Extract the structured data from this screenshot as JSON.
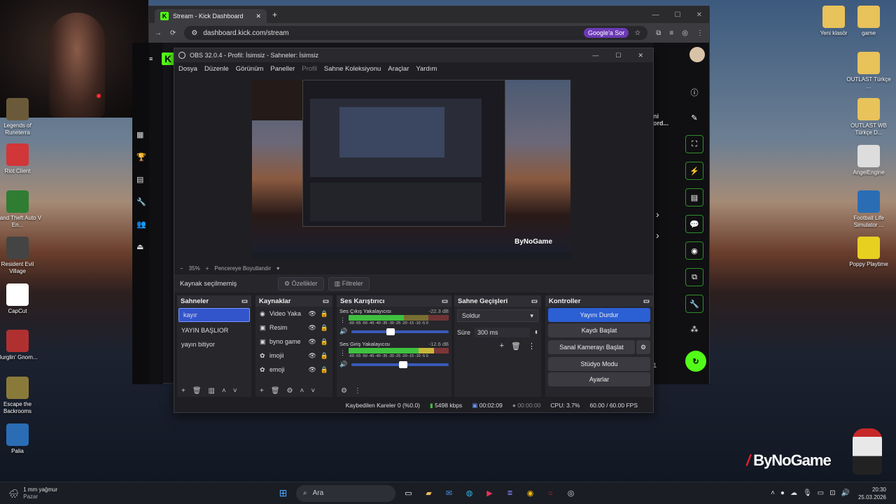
{
  "browser": {
    "tab_title": "Stream - Kick Dashboard",
    "url": "dashboard.kick.com/stream",
    "google_button": "Google'a Sor"
  },
  "kick": {
    "logo": "K",
    "channel_text": "ni\nord...",
    "count": "1"
  },
  "obs": {
    "title": "OBS 32.0.4 - Profil: İsimsiz - Sahneler: İsimsiz",
    "menu": [
      "Dosya",
      "Düzenle",
      "Görünüm",
      "Paneller",
      "Profil",
      "Sahne Koleksiyonu",
      "Araçlar",
      "Yardım"
    ],
    "zoom": "35%",
    "fit_label": "Pencereye Boyutlandır",
    "no_source": "Kaynak seçilmemiş",
    "properties": "Özellikler",
    "filters": "Filtreler",
    "scenes": {
      "title": "Sahneler",
      "items": [
        "kayır",
        "YAYIN BAŞLIOR",
        "yayın bitiyor"
      ]
    },
    "sources": {
      "title": "Kaynaklar",
      "items": [
        "Video Yaka",
        "Resim",
        "byno game",
        "imojii",
        "emoji"
      ]
    },
    "mixer": {
      "title": "Ses Karıştırıcı",
      "ch1_name": "Ses Çıkış Yakalayıcısı",
      "ch1_db": "-22.3 dB",
      "ch2_name": "Ses Giriş Yakalayıcısı",
      "ch2_db": "-12.6 dB",
      "scale": "-60 -55 -50 -45 -40 -35 -30 -25 -20 -15 -10 -5 0"
    },
    "transitions": {
      "title": "Sahne Geçişleri",
      "type": "Soldur",
      "duration_label": "Süre",
      "duration": "300 ms"
    },
    "controls": {
      "title": "Kontroller",
      "stop_stream": "Yayını Durdur",
      "start_record": "Kaydı Başlat",
      "virtual_cam": "Sanal Kamerayı Başlat",
      "studio": "Stüdyo Modu",
      "settings": "Ayarlar"
    },
    "status": {
      "dropped": "Kaybedilen Kareler 0 (%0.0)",
      "bitrate": "5498 kbps",
      "stream_time": "00:02:09",
      "rec_time": "00:00:00",
      "cpu": "CPU: 3.7%",
      "fps": "60.00 / 60.00 FPS"
    },
    "watermark": "ByNoGame"
  },
  "desktop_left": [
    {
      "label": "Legends of Runeterra",
      "color": "#6b5a3a"
    },
    {
      "label": "Riot Client",
      "color": "#d13639"
    },
    {
      "label": "Grand Theft Auto V En...",
      "color": "#2e7d32"
    },
    {
      "label": "Resident Evil Village",
      "color": "#444"
    },
    {
      "label": "CapCut",
      "color": "#ffffff"
    },
    {
      "label": "Burglin' Gnom...",
      "color": "#b03030"
    },
    {
      "label": "Escape the Backrooms",
      "color": "#8a7a3a"
    },
    {
      "label": "Palia",
      "color": "#2a6db5"
    }
  ],
  "desktop_right": [
    {
      "label": "Yeni klasör",
      "color": "#e8c25a"
    },
    {
      "label": "game",
      "color": "#e8c25a"
    },
    {
      "label": "OUTLAST Türkçe ...",
      "color": "#e8c25a"
    },
    {
      "label": "OUTLAST WB Türkçe D...",
      "color": "#e8c25a"
    },
    {
      "label": "AngelEngine",
      "color": "#ddd"
    },
    {
      "label": "Football Life Simulator ...",
      "color": "#2a6db5"
    },
    {
      "label": "Poppy Playtime",
      "color": "#e8d020"
    }
  ],
  "watermark": "ByNoGame",
  "taskbar": {
    "weather": "1 mm yağmur",
    "day": "Pazar",
    "search": "Ara",
    "time": "20:30",
    "date": "25.03.2026"
  }
}
